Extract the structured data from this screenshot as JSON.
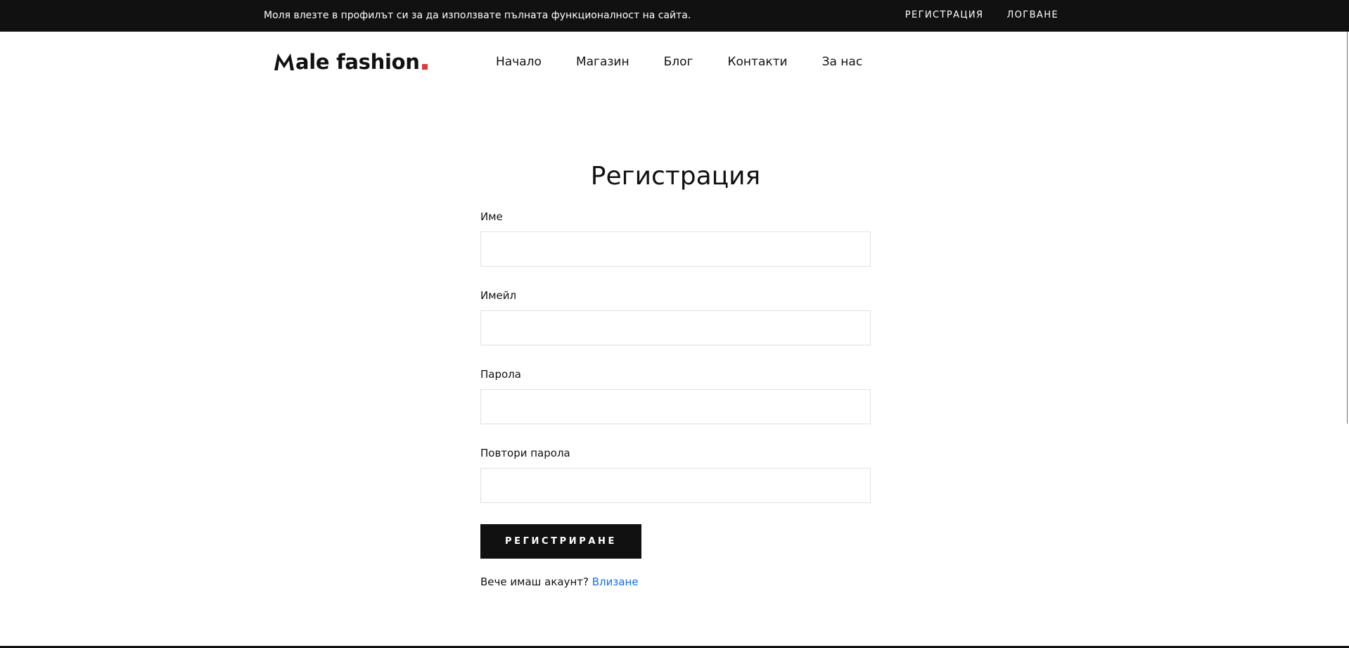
{
  "topbar": {
    "message": "Моля влезте в профилът си за да използвате пълната функционалност на сайта.",
    "links": [
      {
        "label": "РЕГИСТРАЦИЯ"
      },
      {
        "label": "ЛОГВАНЕ"
      }
    ]
  },
  "brand": {
    "logo_text": "ale fashion",
    "accent_color": "#e53637"
  },
  "nav": {
    "items": [
      {
        "label": "Начало"
      },
      {
        "label": "Магазин"
      },
      {
        "label": "Блог"
      },
      {
        "label": "Контакти"
      },
      {
        "label": "За нас"
      }
    ]
  },
  "form": {
    "title": "Регистрация",
    "fields": [
      {
        "label": "Име",
        "value": "",
        "type": "text"
      },
      {
        "label": "Имейл",
        "value": "",
        "type": "email"
      },
      {
        "label": "Парола",
        "value": "",
        "type": "password"
      },
      {
        "label": "Повтори парола",
        "value": "",
        "type": "password"
      }
    ],
    "submit_label": "РЕГИСТРИРАНЕ",
    "login_prompt": "Вече имаш акаунт?",
    "login_link": "Влизане"
  },
  "colors": {
    "dark": "#111111",
    "link": "#0d6efd",
    "input_border": "#e1e1e1"
  }
}
